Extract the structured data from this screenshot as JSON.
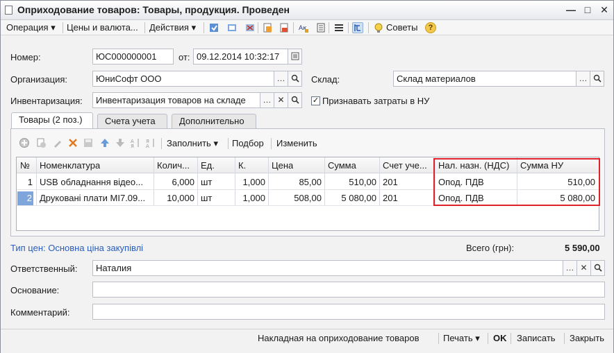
{
  "window": {
    "title": "Оприходование товаров: Товары, продукция. Проведен",
    "minimize": "—",
    "maximize": "□",
    "close": "✕"
  },
  "toolbar": {
    "operation": "Операция",
    "prices": "Цены и валюта...",
    "actions": "Действия",
    "tips": "Советы",
    "help": "?"
  },
  "form": {
    "number_label": "Номер:",
    "number_value": "ЮС000000001",
    "from_label": "от:",
    "date_value": "09.12.2014 10:32:17",
    "org_label": "Организация:",
    "org_value": "ЮниСофт ООО",
    "warehouse_label": "Склад:",
    "warehouse_value": "Склад материалов",
    "inventory_label": "Инвентаризация:",
    "inventory_value": "Инвентаризация товаров на складе",
    "nu_checkbox_label": "Признавать затраты в НУ",
    "nu_checked": true
  },
  "tabs": [
    {
      "label": "Товары (2 поз.)",
      "active": true
    },
    {
      "label": "Счета учета",
      "active": false
    },
    {
      "label": "Дополнительно",
      "active": false
    }
  ],
  "table_toolbar": {
    "fill": "Заполнить",
    "select": "Подбор",
    "change": "Изменить"
  },
  "table": {
    "columns": [
      "№",
      "Номенклатура",
      "Колич...",
      "Ед.",
      "К.",
      "Цена",
      "Сумма",
      "Счет уче...",
      "Нал. назн. (НДС)",
      "Сумма НУ"
    ],
    "rows": [
      [
        "1",
        "USB обладнання відео...",
        "6,000",
        "шт",
        "1,000",
        "85,00",
        "510,00",
        "201",
        "Опод. ПДВ",
        "510,00"
      ],
      [
        "2",
        "Друковані плати MI7.09...",
        "10,000",
        "шт",
        "1,000",
        "508,00",
        "5 080,00",
        "201",
        "Опод. ПДВ",
        "5 080,00"
      ]
    ]
  },
  "summary": {
    "price_type": "Тип цен: Основна ціна закупівлі",
    "total_label": "Всего (грн):",
    "total_value": "5 590,00"
  },
  "bottom": {
    "responsible_label": "Ответственный:",
    "responsible_value": "Наталия",
    "basis_label": "Основание:",
    "basis_value": "",
    "comment_label": "Комментарий:",
    "comment_value": ""
  },
  "footer": {
    "waybill": "Накладная на оприходование товаров",
    "print": "Печать",
    "ok": "OK",
    "save": "Записать",
    "close": "Закрыть"
  },
  "colors": {
    "highlight": "#e0202a",
    "link": "#2a5dba",
    "selection": "#c8d8ee"
  }
}
